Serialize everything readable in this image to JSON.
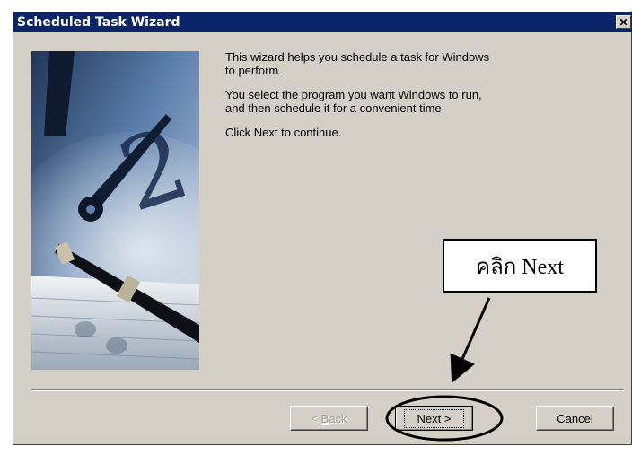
{
  "window": {
    "title": "Scheduled Task Wizard",
    "close_symbol": "✕"
  },
  "body": {
    "paragraphs": [
      "This wizard helps you schedule a task for Windows\nto perform.",
      "You select the program you want Windows to run,\nand then schedule it for a convenient time.",
      "Click Next to continue."
    ]
  },
  "buttons": {
    "back": {
      "prefix": "< ",
      "accel": "B",
      "rest": "ack",
      "enabled": false
    },
    "next": {
      "accel": "N",
      "rest": "ext >",
      "enabled": true
    },
    "cancel": {
      "label": "Cancel"
    }
  },
  "annotation": {
    "label": "คลิก  Next"
  },
  "icons": [
    "close-icon",
    "wizard-clock-pen-image"
  ],
  "colors": {
    "titlebar": "#0a246a",
    "dialog": "#d4d0c8",
    "image_blue": "#4a6f9a"
  }
}
